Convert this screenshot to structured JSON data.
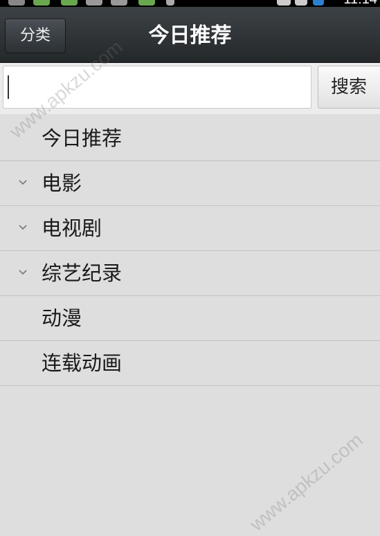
{
  "status_bar": {
    "clock": "11:14",
    "icons": [
      "search-icon",
      "app-icon",
      "app-icon",
      "image-icon",
      "image-icon",
      "app-icon",
      "download-icon",
      "wifi-icon",
      "signal-icon",
      "battery-icon"
    ]
  },
  "action_bar": {
    "category_button": "分类",
    "title": "今日推荐"
  },
  "search": {
    "value": "",
    "placeholder": "",
    "button_label": "搜索"
  },
  "categories": [
    {
      "label": "今日推荐",
      "expandable": false
    },
    {
      "label": "电影",
      "expandable": true
    },
    {
      "label": "电视剧",
      "expandable": true
    },
    {
      "label": "综艺纪录",
      "expandable": true
    },
    {
      "label": "动漫",
      "expandable": false
    },
    {
      "label": "连载动画",
      "expandable": false
    }
  ],
  "watermark": "www.apkzu.com",
  "colors": {
    "action_bar": "#2e3337",
    "list_background": "#dedede",
    "divider": "#c2c2c2"
  }
}
